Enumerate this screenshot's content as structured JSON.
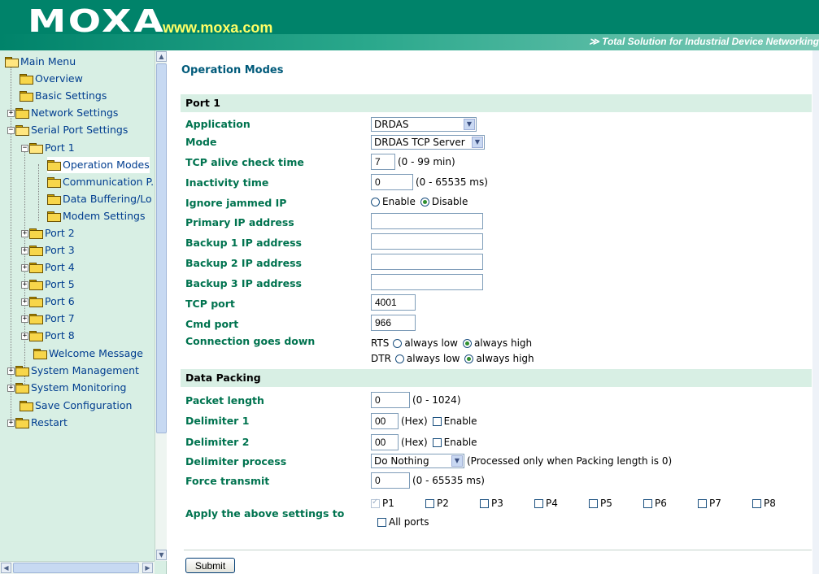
{
  "header": {
    "logo": "MOXA",
    "url": "www.moxa.com",
    "tagline": "≫ Total Solution for Industrial Device Networking"
  },
  "tree": {
    "main_menu": "Main Menu",
    "overview": "Overview",
    "basic_settings": "Basic Settings",
    "network_settings": "Network Settings",
    "serial_port_settings": "Serial Port Settings",
    "port1": "Port 1",
    "operation_modes": "Operation Modes",
    "communication": "Communication P.",
    "data_buffering": "Data Buffering/Lo",
    "modem_settings": "Modem Settings",
    "port2": "Port 2",
    "port3": "Port 3",
    "port4": "Port 4",
    "port5": "Port 5",
    "port6": "Port 6",
    "port7": "Port 7",
    "port8": "Port 8",
    "welcome_message": "Welcome Message",
    "system_management": "System Management",
    "system_monitoring": "System Monitoring",
    "save_configuration": "Save Configuration",
    "restart": "Restart"
  },
  "page": {
    "title": "Operation Modes",
    "port_section": "Port 1",
    "packing_section": "Data Packing"
  },
  "fields": {
    "application": {
      "label": "Application",
      "value": "DRDAS"
    },
    "mode": {
      "label": "Mode",
      "value": "DRDAS TCP Server"
    },
    "tcp_alive": {
      "label": "TCP alive check time",
      "value": "7",
      "unit": "(0 - 99 min)"
    },
    "inactivity": {
      "label": "Inactivity time",
      "value": "0",
      "unit": "(0 - 65535 ms)"
    },
    "ignore_jammed": {
      "label": "Ignore jammed IP",
      "opt1": "Enable",
      "opt2": "Disable"
    },
    "primary_ip": {
      "label": "Primary IP address",
      "value": ""
    },
    "backup1_ip": {
      "label": "Backup 1 IP address",
      "value": ""
    },
    "backup2_ip": {
      "label": "Backup 2 IP address",
      "value": ""
    },
    "backup3_ip": {
      "label": "Backup 3 IP address",
      "value": ""
    },
    "tcp_port": {
      "label": "TCP port",
      "value": "4001"
    },
    "cmd_port": {
      "label": "Cmd port",
      "value": "966"
    },
    "connection_down": {
      "label": "Connection goes down",
      "rts": "RTS",
      "dtr": "DTR",
      "low": "always low",
      "high": "always high"
    },
    "packet_length": {
      "label": "Packet length",
      "value": "0",
      "unit": "(0 - 1024)"
    },
    "delimiter1": {
      "label": "Delimiter 1",
      "value": "00",
      "hex": "(Hex)",
      "enable": "Enable"
    },
    "delimiter2": {
      "label": "Delimiter 2",
      "value": "00",
      "hex": "(Hex)",
      "enable": "Enable"
    },
    "delimiter_process": {
      "label": "Delimiter process",
      "value": "Do Nothing",
      "note": "(Processed only when Packing length is 0)"
    },
    "force_transmit": {
      "label": "Force transmit",
      "value": "0",
      "unit": "(0 - 65535 ms)"
    },
    "apply": {
      "label": "Apply the above settings to",
      "ports": [
        "P1",
        "P2",
        "P3",
        "P4",
        "P5",
        "P6",
        "P7",
        "P8"
      ],
      "all_ports": "All ports"
    }
  },
  "submit_label": "Submit"
}
